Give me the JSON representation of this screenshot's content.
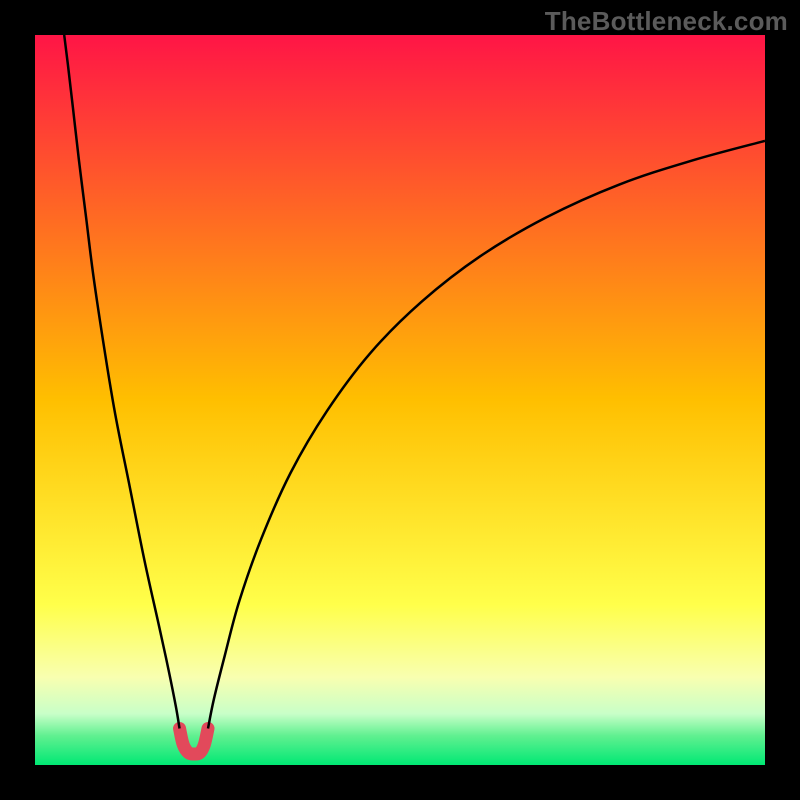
{
  "watermark": "TheBottleneck.com",
  "chart_data": {
    "type": "line",
    "title": "",
    "xlabel": "",
    "ylabel": "",
    "xlim": [
      0,
      100
    ],
    "ylim": [
      0,
      100
    ],
    "gradient_stops": [
      {
        "offset": 0.0,
        "color": "#ff1546"
      },
      {
        "offset": 0.5,
        "color": "#ffbf00"
      },
      {
        "offset": 0.78,
        "color": "#ffff4a"
      },
      {
        "offset": 0.88,
        "color": "#f8ffb0"
      },
      {
        "offset": 0.93,
        "color": "#c8ffc8"
      },
      {
        "offset": 0.96,
        "color": "#60f090"
      },
      {
        "offset": 1.0,
        "color": "#00e874"
      }
    ],
    "series": [
      {
        "name": "left-branch-thin",
        "color": "#000000",
        "width": 2.5,
        "points": [
          {
            "x": 4.0,
            "y": 100.0
          },
          {
            "x": 4.5,
            "y": 96.0
          },
          {
            "x": 5.2,
            "y": 90.0
          },
          {
            "x": 6.0,
            "y": 83.0
          },
          {
            "x": 7.0,
            "y": 75.0
          },
          {
            "x": 8.0,
            "y": 67.0
          },
          {
            "x": 9.5,
            "y": 57.0
          },
          {
            "x": 11.0,
            "y": 48.0
          },
          {
            "x": 13.0,
            "y": 38.0
          },
          {
            "x": 15.0,
            "y": 28.0
          },
          {
            "x": 17.0,
            "y": 19.0
          },
          {
            "x": 18.3,
            "y": 13.0
          },
          {
            "x": 19.3,
            "y": 8.0
          },
          {
            "x": 19.8,
            "y": 5.0
          }
        ]
      },
      {
        "name": "right-branch-thin",
        "color": "#000000",
        "width": 2.5,
        "points": [
          {
            "x": 23.7,
            "y": 5.0
          },
          {
            "x": 24.5,
            "y": 9.0
          },
          {
            "x": 26.0,
            "y": 15.0
          },
          {
            "x": 28.0,
            "y": 22.5
          },
          {
            "x": 31.0,
            "y": 31.0
          },
          {
            "x": 35.0,
            "y": 40.0
          },
          {
            "x": 40.0,
            "y": 48.5
          },
          {
            "x": 46.0,
            "y": 56.5
          },
          {
            "x": 53.0,
            "y": 63.5
          },
          {
            "x": 61.0,
            "y": 69.7
          },
          {
            "x": 70.0,
            "y": 75.0
          },
          {
            "x": 80.0,
            "y": 79.5
          },
          {
            "x": 90.0,
            "y": 82.8
          },
          {
            "x": 100.0,
            "y": 85.5
          }
        ]
      },
      {
        "name": "valley-thick",
        "color": "#e2495b",
        "width": 13,
        "cap": "round",
        "points": [
          {
            "x": 19.8,
            "y": 5.0
          },
          {
            "x": 20.3,
            "y": 2.8
          },
          {
            "x": 21.0,
            "y": 1.7
          },
          {
            "x": 21.8,
            "y": 1.5
          },
          {
            "x": 22.6,
            "y": 1.7
          },
          {
            "x": 23.2,
            "y": 2.8
          },
          {
            "x": 23.7,
            "y": 5.0
          }
        ]
      }
    ]
  }
}
